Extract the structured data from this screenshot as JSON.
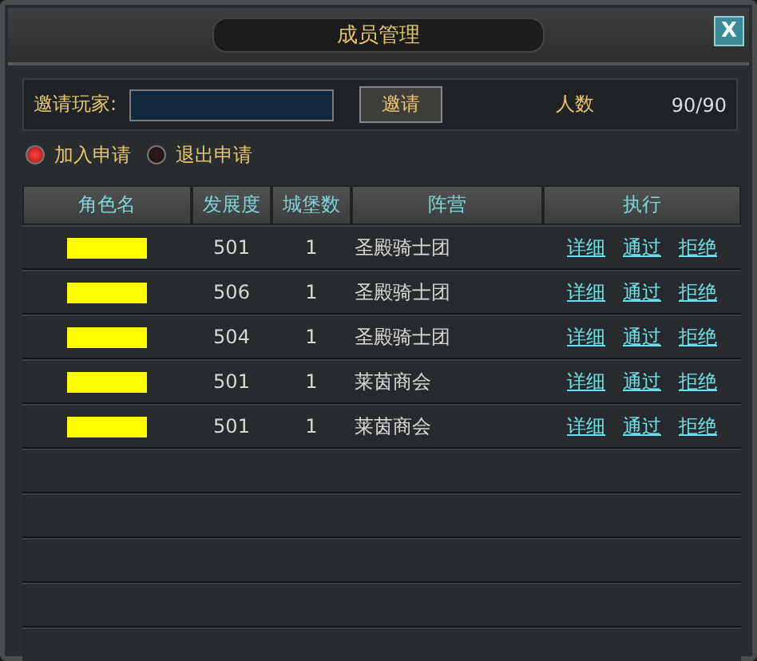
{
  "window": {
    "title": "成员管理",
    "close": "X"
  },
  "invite": {
    "label": "邀请玩家:",
    "button": "邀请",
    "count_label": "人数",
    "count": "90/90"
  },
  "filters": [
    {
      "label": "加入申请",
      "selected": true
    },
    {
      "label": "退出申请",
      "selected": false
    }
  ],
  "table": {
    "columns": [
      "角色名",
      "发展度",
      "城堡数",
      "阵营",
      "执行"
    ],
    "rows": [
      {
        "name_redacted": true,
        "development": "501",
        "castles": "1",
        "faction": "圣殿骑士团",
        "actions": [
          "详细",
          "通过",
          "拒绝"
        ]
      },
      {
        "name_redacted": true,
        "development": "506",
        "castles": "1",
        "faction": "圣殿骑士团",
        "actions": [
          "详细",
          "通过",
          "拒绝"
        ]
      },
      {
        "name_redacted": true,
        "development": "504",
        "castles": "1",
        "faction": "圣殿骑士团",
        "actions": [
          "详细",
          "通过",
          "拒绝"
        ]
      },
      {
        "name_redacted": true,
        "development": "501",
        "castles": "1",
        "faction": "莱茵商会",
        "actions": [
          "详细",
          "通过",
          "拒绝"
        ]
      },
      {
        "name_redacted": true,
        "development": "501",
        "castles": "1",
        "faction": "莱茵商会",
        "actions": [
          "详细",
          "通过",
          "拒绝"
        ]
      }
    ]
  }
}
